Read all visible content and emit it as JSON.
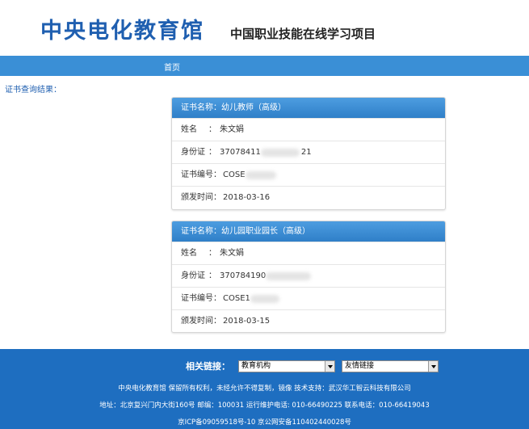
{
  "header": {
    "logo_title": "中央电化教育馆",
    "subtitle": "中国职业技能在线学习项目"
  },
  "nav": {
    "items": [
      {
        "label": "首页"
      }
    ]
  },
  "result_label": "证书查询结果：",
  "certificates": [
    {
      "title": "证书名称：幼儿教师（高级）",
      "name_label": "姓名",
      "name_sep": "：",
      "name_value": "朱文娟",
      "id_label": "身份证",
      "id_sep": "：",
      "id_prefix": "37078411",
      "id_suffix": "21",
      "cert_no_label": "证书编号：",
      "cert_no_prefix": "COSE",
      "issue_label": "颁发时间：",
      "issue_date": "2018-03-16"
    },
    {
      "title": "证书名称：幼儿园职业园长（高级）",
      "name_label": "姓名",
      "name_sep": "：",
      "name_value": "朱文娟",
      "id_label": "身份证",
      "id_sep": "：",
      "id_prefix": "370784190",
      "id_suffix": "",
      "cert_no_label": "证书编号：",
      "cert_no_prefix": "COSE1",
      "issue_label": "颁发时间：",
      "issue_date": "2018-03-15"
    }
  ],
  "footer": {
    "links_label": "相关链接：",
    "select1_value": "教育机构",
    "select2_value": "友情链接",
    "line1": "中央电化教育馆 保留所有权利，未经允许不得复制，镜像 技术支持：武汉华工智云科技有限公司",
    "line2": "地址：北京复兴门内大街160号 邮编：100031 运行维护电话: 010-66490225 联系电话：010-66419043",
    "line3": "京ICP备09059518号-10 京公网安备110402440028号"
  }
}
